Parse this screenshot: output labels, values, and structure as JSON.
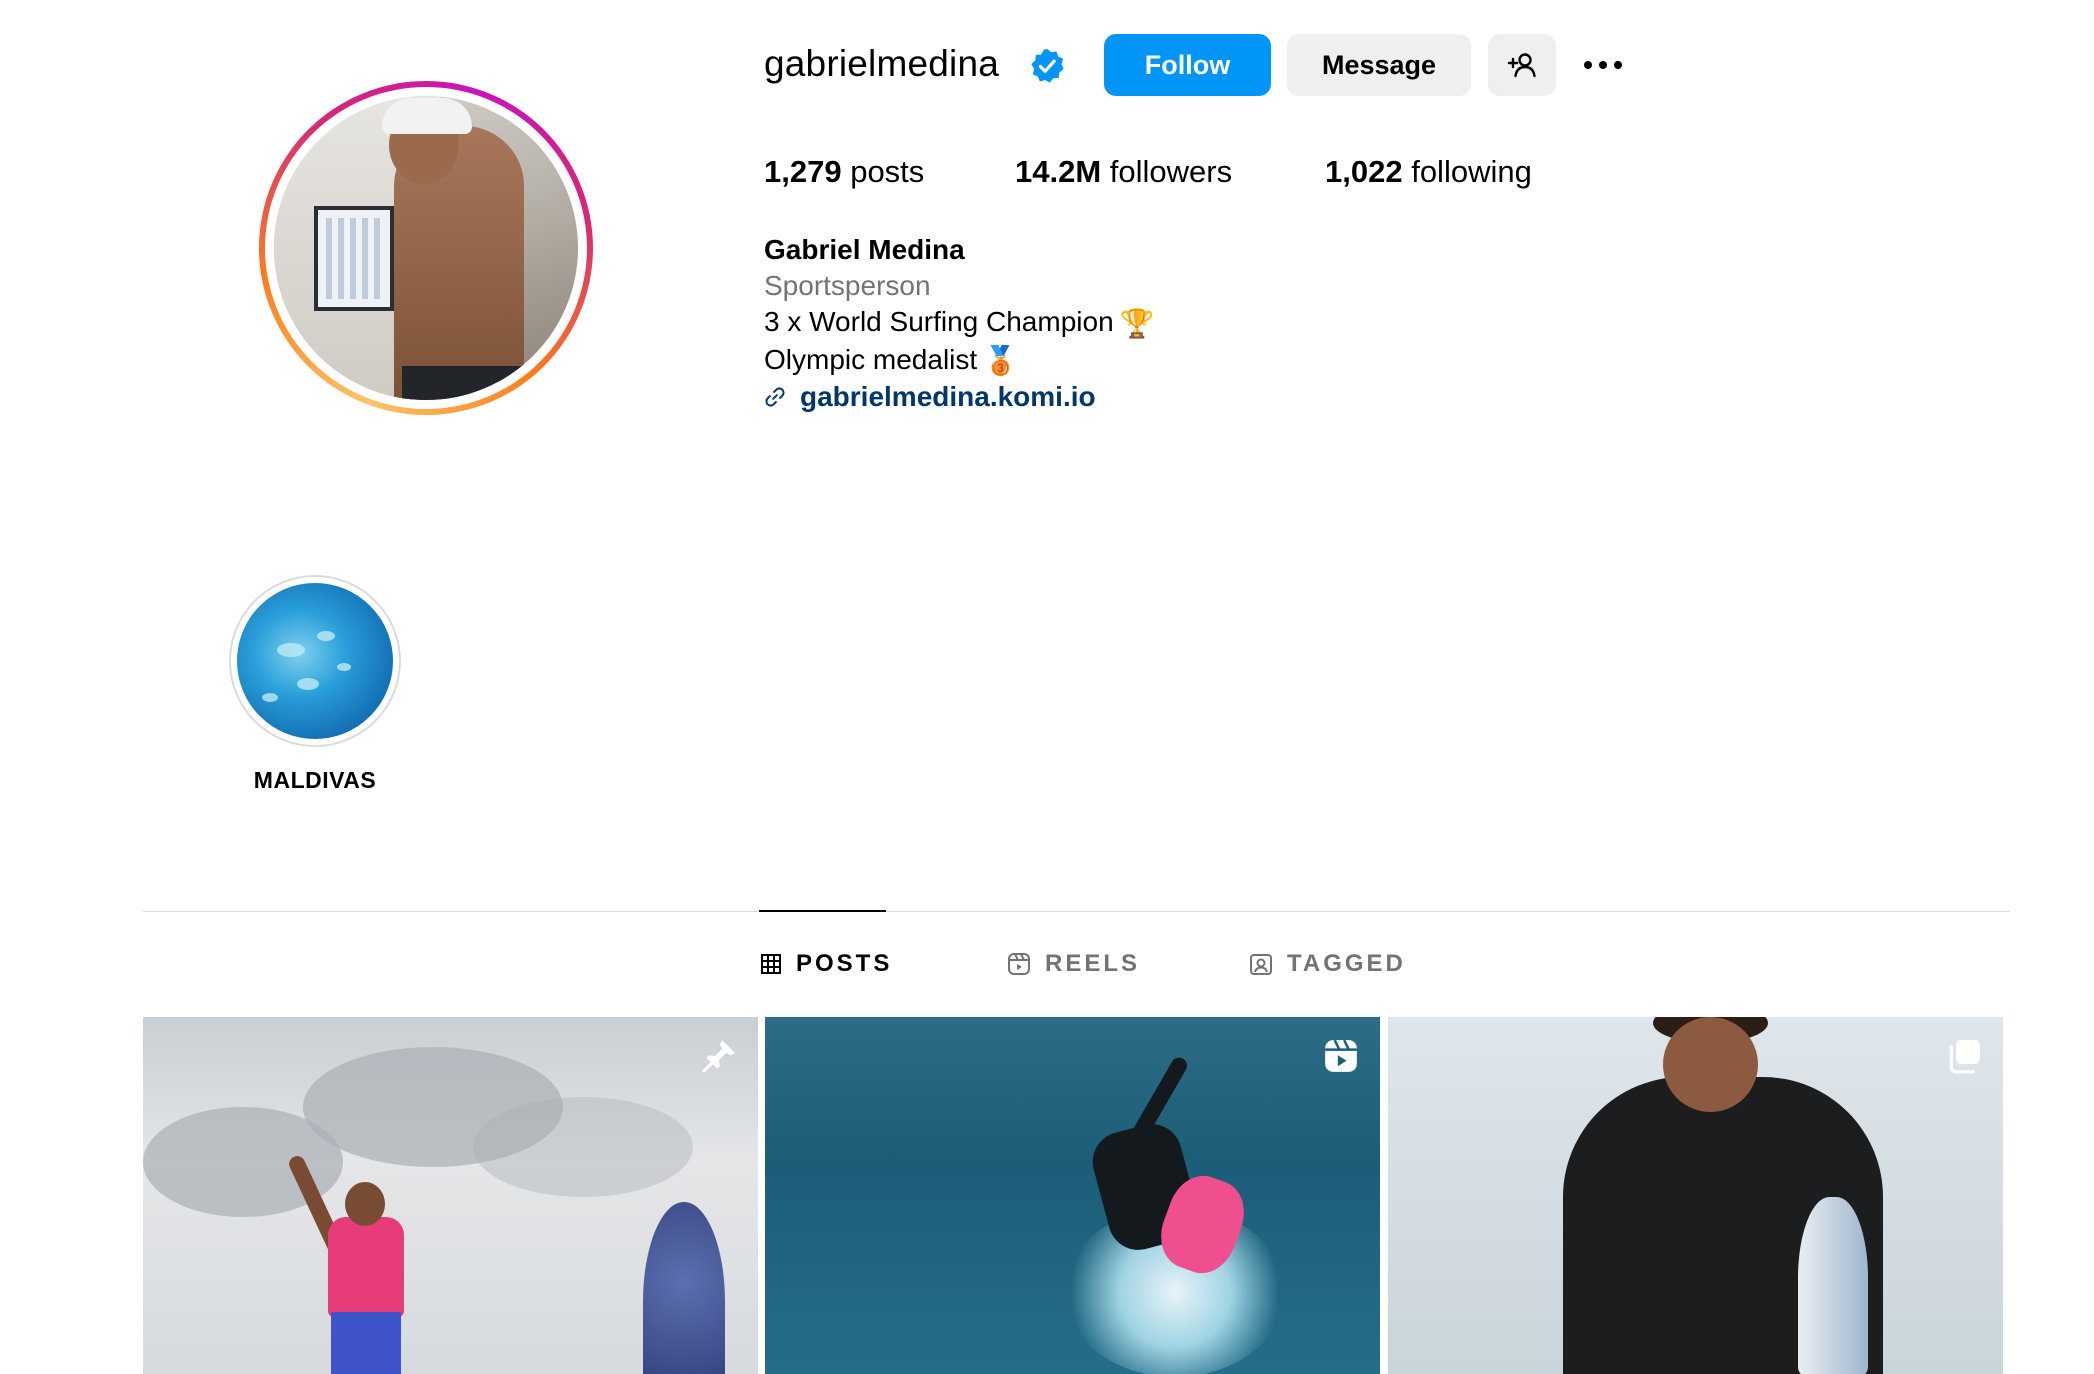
{
  "profile": {
    "username": "gabrielmedina",
    "verified_icon": "verified-badge-icon",
    "follow_label": "Follow",
    "message_label": "Message",
    "stats": {
      "posts_count": "1,279",
      "posts_label": "posts",
      "followers_count": "14.2M",
      "followers_label": "followers",
      "following_count": "1,022",
      "following_label": "following"
    },
    "bio": {
      "full_name": "Gabriel Medina",
      "category": "Sportsperson",
      "line1": "3 x World Surfing Champion",
      "line1_emoji": "🏆",
      "line2": "Olympic medalist",
      "line2_emoji": "🥉",
      "link": "gabrielmedina.komi.io"
    }
  },
  "highlights": [
    {
      "label": "MALDIVAS"
    }
  ],
  "tabs": [
    {
      "label": "POSTS",
      "icon": "grid-icon",
      "active": true
    },
    {
      "label": "REELS",
      "icon": "reels-icon",
      "active": false
    },
    {
      "label": "TAGGED",
      "icon": "tagged-icon",
      "active": false
    }
  ],
  "posts": [
    {
      "badge_icon": "pin-icon"
    },
    {
      "badge_icon": "reel-badge-icon"
    },
    {
      "badge_icon": "carousel-icon"
    }
  ],
  "colors": {
    "follow_button": "#0095f6",
    "secondary_button": "#efefef",
    "link": "#00376b",
    "muted_text": "#737373",
    "verified": "#0095f6"
  }
}
